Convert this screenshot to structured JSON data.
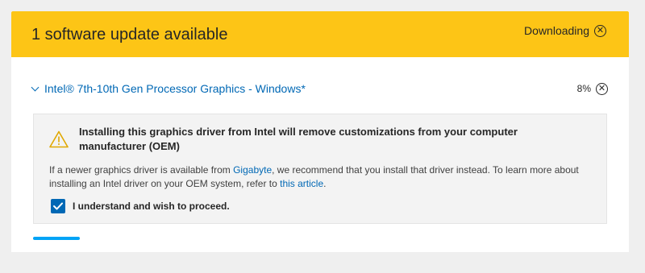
{
  "banner": {
    "title": "1 software update available",
    "status_label": "Downloading",
    "cancel_icon": "close-circle-icon"
  },
  "driver": {
    "name": "Intel® 7th-10th Gen Processor Graphics - Windows*",
    "progress_percent": "8%",
    "progress_fraction": 0.08,
    "cancel_icon": "close-circle-icon"
  },
  "notice": {
    "title": "Installing this graphics driver from Intel will remove customizations from your computer manufacturer (OEM)",
    "body_part1": "If a newer graphics driver is available from ",
    "gigabyte_link": "Gigabyte",
    "body_part2": ", we recommend that you install that driver instead. To learn more about installing an Intel driver on your OEM system, refer to ",
    "article_link": "this article",
    "body_part3": ".",
    "consent_label": "I understand and wish to proceed.",
    "consent_checked": true
  },
  "colors": {
    "banner": "#fdc516",
    "link": "#0068b5",
    "progress": "#00a3f6",
    "background": "#efefef"
  }
}
